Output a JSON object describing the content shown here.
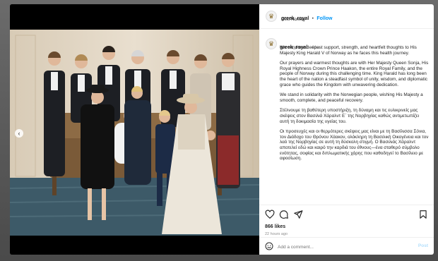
{
  "post": {
    "username": "greek_royal",
    "follow_label": "Follow",
    "separator": "•",
    "location": "Oslo Norway",
    "caption_age": "61w",
    "likes": "866 likes",
    "time_ago": "22 hours ago",
    "comment_placeholder": "Add a comment...",
    "post_label": "Post"
  },
  "caption": {
    "p1": "We send our deepest support, strength, and heartfelt thoughts to His Majesty King Harald V of Norway as he faces this health journey.",
    "p2": "Our prayers and warmest thoughts are with Her Majesty Queen Sonja, His Royal Highness Crown Prince Haakon, the entire Royal Family, and the people of Norway during this challenging time. King Harald has long been the heart of the nation a steadfast symbol of unity, wisdom, and diplomatic grace who guides the Kingdom with unwavering dedication.",
    "p3": "We stand in solidarity with the Norwegian people, wishing His Majesty a smooth, complete, and peaceful recovery.",
    "p4": "Στέλνουμε τη βαθύτερη υποστήριξη, τη δύναμη και τις ευλικρινείς μας σκέψεις στον Βασιλιά Χάραλντ Ε΄ της Νορβηγίας καθώς αντιμετωπίζει αυτή τη δοκιμασία της υγείας του.",
    "p5": "Οι προσευχές και οι θερμότερες σκέψεις μας είναι με τη Βασίλισσα Σόνια, τον Διάδοχο του Θρόνου Χάακον, ολόκληρη τη Βασιλική Οικογένεια και τον λαό της Νορβηγίας σε αυτή τη δύσκολη στιγμή. Ο Βασιλιάς Χάραλντ αποτελεί εδώ και καιρό την καρδιά του έθνους—ένα σταθερό σύμβολο ενότητας, σοφίας και διπλωματικής χάρης που καθοδηγεί το Βασίλειο με αφοσίωση."
  },
  "icons": {
    "avatar": "crest-icon",
    "prev": "chevron-left-icon",
    "like": "heart-icon",
    "comment": "comment-icon",
    "share": "share-icon",
    "save": "bookmark-icon",
    "emoji": "smiley-icon"
  },
  "colors": {
    "follow": "#0095f6",
    "post_disabled": "#b2dffc",
    "text": "#262626",
    "muted": "#8e8e8e"
  }
}
